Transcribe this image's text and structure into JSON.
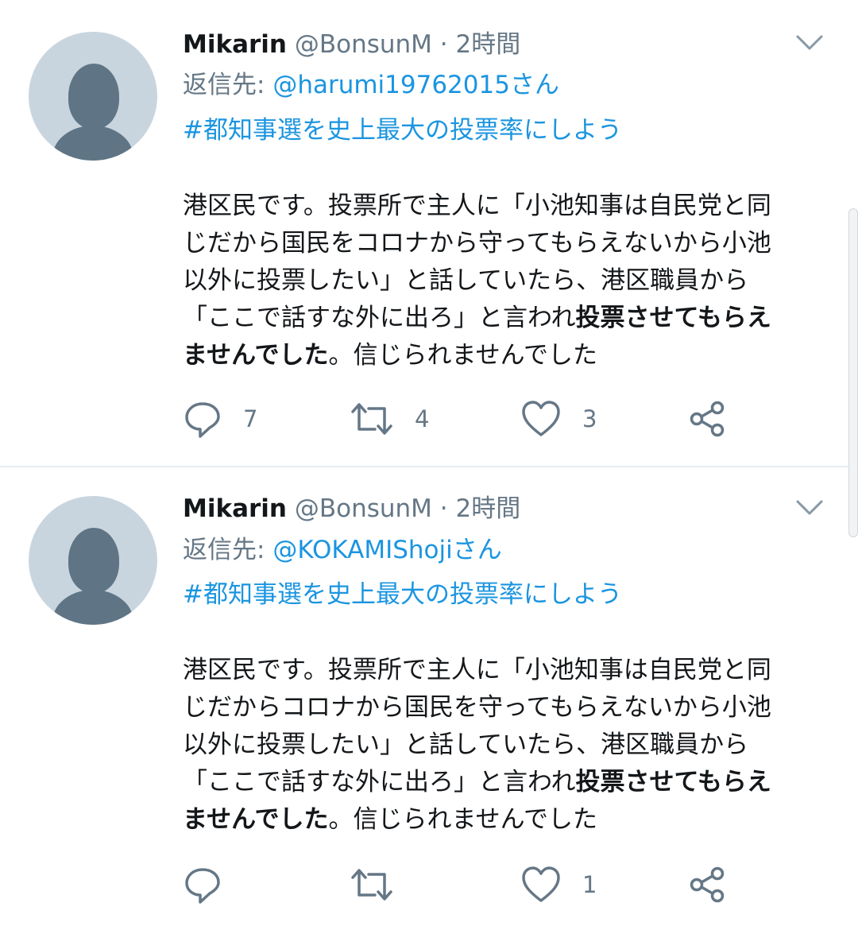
{
  "tweets": [
    {
      "name": "Mikarin",
      "handle": "@BonsunM",
      "separator": "·",
      "time": "2時間",
      "reply_prefix": "返信先: ",
      "reply_to": "@harumi19762015さん",
      "hashtag": "#都知事選を史上最大の投票率にしよう",
      "body_before_bold": "港区民です。投票所で主人に「小池知事は自民党と同\nじだから国民をコロナから守ってもらえないから小池\n以外に投票したい」と話していたら、港区職員から\n「ここで話すな外に出ろ」と言われ",
      "body_bold": "投票させてもらえ\nませんでした",
      "body_after_bold": "。信じられませんでした",
      "replies": "7",
      "retweets": "4",
      "likes": "3"
    },
    {
      "name": "Mikarin",
      "handle": "@BonsunM",
      "separator": "·",
      "time": "2時間",
      "reply_prefix": "返信先: ",
      "reply_to": "@KOKAMIShojiさん",
      "hashtag": "#都知事選を史上最大の投票率にしよう",
      "body_before_bold": "港区民です。投票所で主人に「小池知事は自民党と同\nじだからコロナから国民を守ってもらえないから小池\n以外に投票したい」と話していたら、港区職員から\n「ここで話すな外に出ろ」と言われ",
      "body_bold": "投票させてもらえ\nませんでした",
      "body_after_bold": "。信じられませんでした",
      "replies": "",
      "retweets": "",
      "likes": "1"
    }
  ],
  "icons": {
    "reply": "reply-icon",
    "retweet": "retweet-icon",
    "like": "heart-icon",
    "share": "share-icon",
    "menu": "chevron-down-icon"
  },
  "colors": {
    "link": "#1b95e0",
    "secondary_text": "#657786",
    "avatar_bg": "#c9d5de",
    "avatar_fg": "#5f7585"
  }
}
